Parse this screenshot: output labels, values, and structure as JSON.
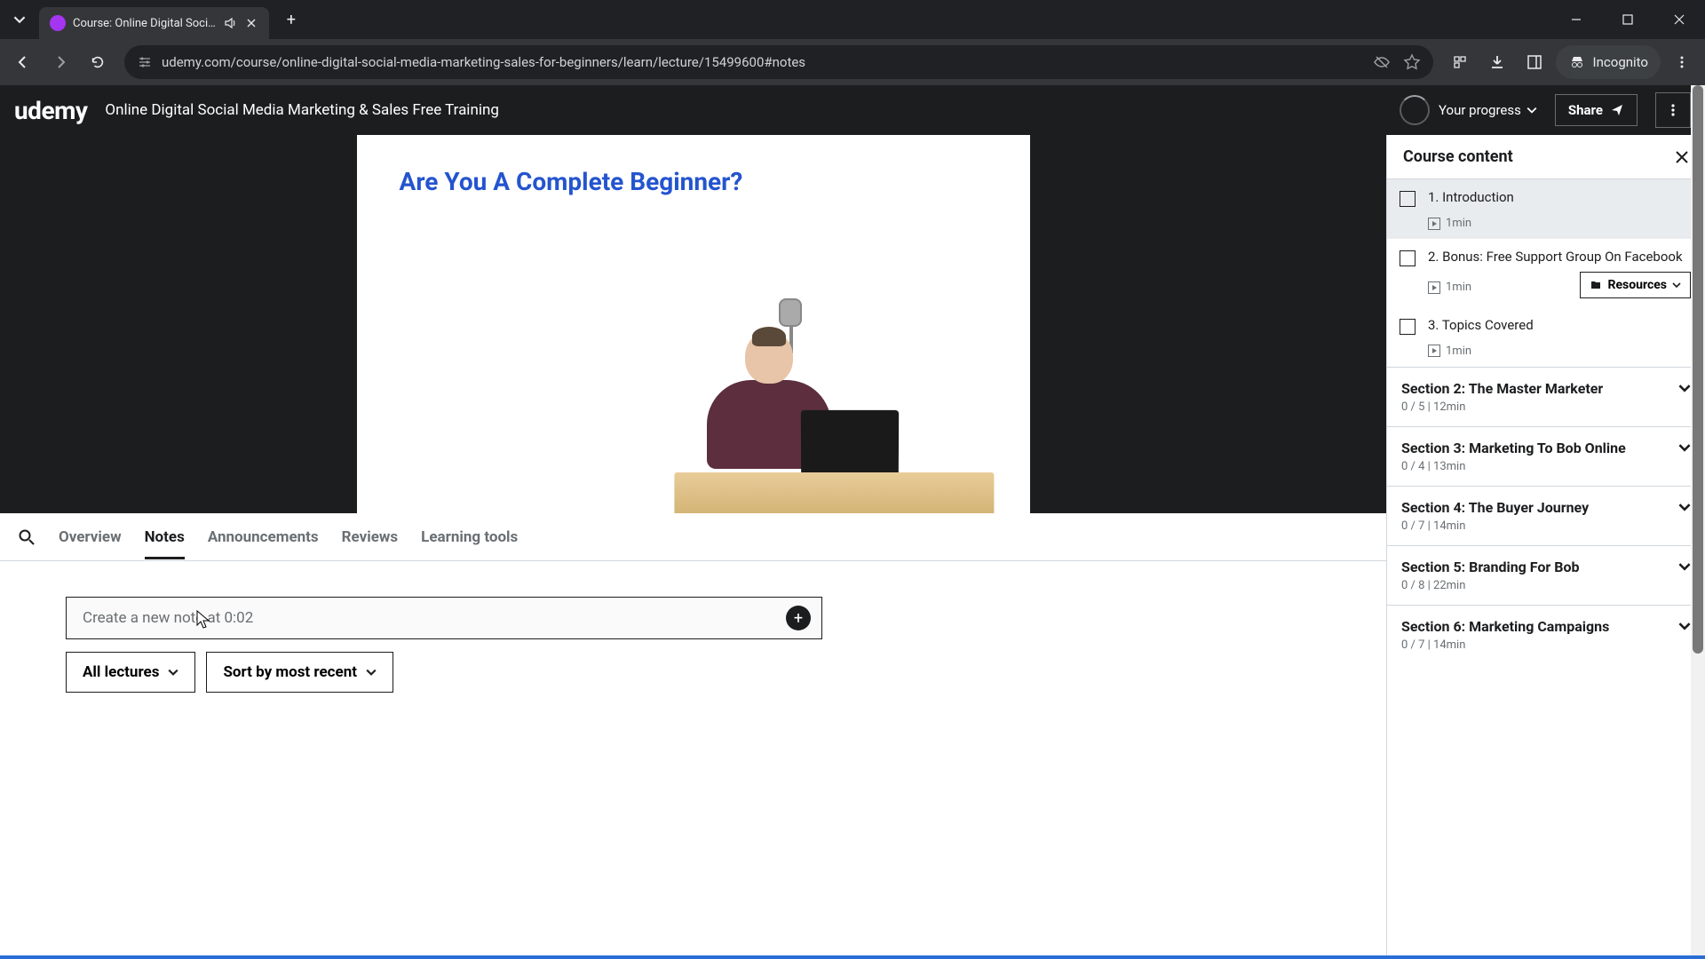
{
  "browser": {
    "tab_title": "Course: Online Digital Soci…",
    "url": "udemy.com/course/online-digital-social-media-marketing-sales-for-beginners/learn/lecture/15499600#notes",
    "incognito_label": "Incognito"
  },
  "header": {
    "logo": "udemy",
    "course_title": "Online Digital Social Media Marketing & Sales Free Training",
    "progress_label": "Your progress",
    "share_label": "Share"
  },
  "video": {
    "slide_heading": "Are You A Complete Beginner?"
  },
  "tabs": {
    "items": [
      "Overview",
      "Notes",
      "Announcements",
      "Reviews",
      "Learning tools"
    ],
    "active_index": 1
  },
  "notes": {
    "placeholder": "Create a new note at 0:02",
    "filter_lectures": "All lectures",
    "filter_sort": "Sort by most recent"
  },
  "sidebar": {
    "title": "Course content",
    "lectures": [
      {
        "title": "1. Introduction",
        "duration": "1min",
        "current": true,
        "resources": false
      },
      {
        "title": "2. Bonus: Free Support Group On Facebook",
        "duration": "1min",
        "current": false,
        "resources": true
      },
      {
        "title": "3. Topics Covered",
        "duration": "1min",
        "current": false,
        "resources": false
      }
    ],
    "resources_label": "Resources",
    "sections": [
      {
        "title": "Section 2: The Master Marketer",
        "meta": "0 / 5 | 12min"
      },
      {
        "title": "Section 3: Marketing To Bob Online",
        "meta": "0 / 4 | 13min"
      },
      {
        "title": "Section 4: The Buyer Journey",
        "meta": "0 / 7 | 14min"
      },
      {
        "title": "Section 5: Branding For Bob",
        "meta": "0 / 8 | 22min"
      },
      {
        "title": "Section 6: Marketing Campaigns",
        "meta": "0 / 7 | 14min"
      }
    ]
  }
}
